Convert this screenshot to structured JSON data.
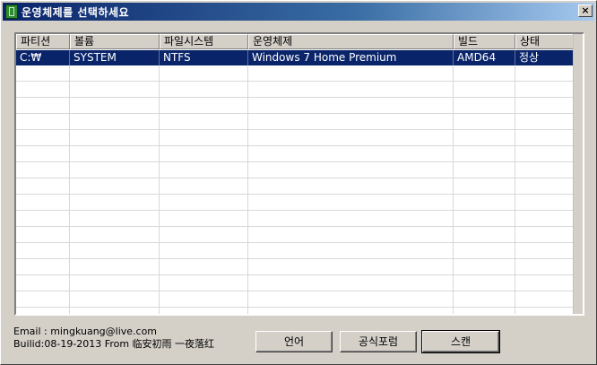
{
  "window": {
    "title": "운영체제를 선택하세요",
    "close_label": "×"
  },
  "table": {
    "columns": [
      "파티션",
      "볼륨",
      "파일시스템",
      "운영체제",
      "빌드",
      "상태"
    ],
    "rows": [
      [
        "C:₩",
        "SYSTEM",
        "NTFS",
        "Windows 7 Home Premium",
        "AMD64",
        "정상"
      ]
    ],
    "selected_row": 0
  },
  "footer": {
    "email": "Email : mingkuang@live.com",
    "build": "Builid:08-19-2013 From 临安初雨 一夜落红"
  },
  "buttons": {
    "language": "언어",
    "forum": "공식포럼",
    "scan": "스캔"
  },
  "colors": {
    "title_gradient_start": "#0a246a",
    "selection": "#0a246a",
    "face": "#d4d0c8"
  }
}
